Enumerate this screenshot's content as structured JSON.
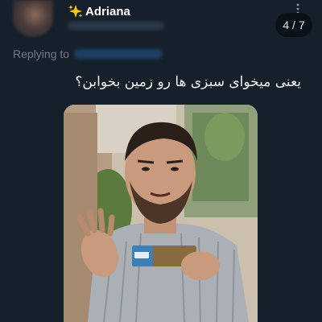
{
  "tweet": {
    "author": {
      "display_name": "Adriana",
      "emoji_icon": "sparkles-icon"
    },
    "image_counter": "4 / 7",
    "replying_label": "Replying to",
    "text": "یعنی میخوای سبزی ها رو زمین بخوابن؟"
  },
  "colors": {
    "background": "#15202b",
    "text": "#ffffff",
    "muted": "#6e7a86",
    "link": "#1d9bf0",
    "accent": "#f5c518"
  }
}
